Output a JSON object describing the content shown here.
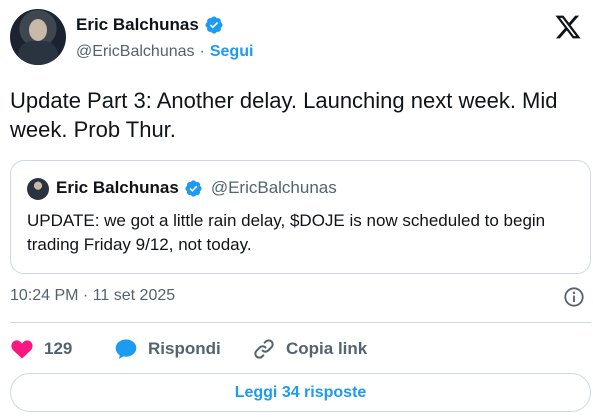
{
  "author": {
    "name": "Eric Balchunas",
    "handle": "@EricBalchunas",
    "separator": "·",
    "follow_label": "Segui"
  },
  "tweet": {
    "text": "Update Part 3: Another delay. Launching next week. Mid week. Prob Thur."
  },
  "quoted_tweet": {
    "name": "Eric Balchunas",
    "handle": "@EricBalchunas",
    "text": "UPDATE: we got a little rain delay, $DOJE is now scheduled to begin trading Friday 9/12, not today."
  },
  "meta": {
    "timestamp": "10:24 PM · 11 set 2025"
  },
  "actions": {
    "likes_count": "129",
    "reply_label": "Rispondi",
    "copy_link_label": "Copia link"
  },
  "footer": {
    "read_replies_label": "Leggi 34 risposte"
  },
  "colors": {
    "accent": "#1d9bf0",
    "like": "#f91880",
    "verified": "#1d9bf0",
    "secondary_text": "#536471",
    "border": "#cfd9de"
  },
  "icons": {
    "logo": "x-logo-icon",
    "verified": "verified-badge-icon",
    "info": "info-icon",
    "like": "heart-icon",
    "reply": "speech-bubble-icon",
    "copy_link": "link-icon"
  }
}
